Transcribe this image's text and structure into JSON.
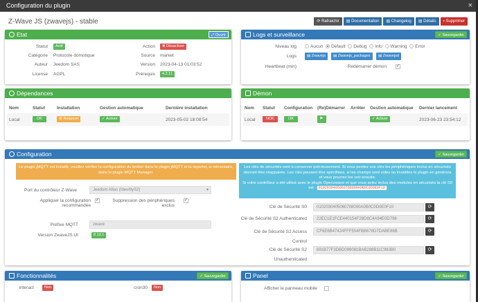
{
  "window": {
    "title": "Configuration du plugin",
    "close": "×"
  },
  "plugin_title": "Z-Wave JS (zwavejs) - stable",
  "toolbar": {
    "refresh": "Rafraichir",
    "doc": "Documentation",
    "changelog": "Changelog",
    "details": "Détails",
    "delete": "Supprimer"
  },
  "etat": {
    "title": "Etat",
    "open": "Ouvrir",
    "statut_lbl": "Statut",
    "statut": "Actif",
    "categorie_lbl": "Catégorie",
    "categorie": "Protocole domotique",
    "auteur_lbl": "Auteur",
    "auteur": "Jeedom SAS",
    "licence_lbl": "License",
    "licence": "AGPL",
    "action_lbl": "Action",
    "action": "Désactiver",
    "source_lbl": "Source",
    "source": "market",
    "version_lbl": "Version",
    "version": "2023-04-13 01:03:52",
    "prerequis_lbl": "Prérequis",
    "prerequis": "4.2.11"
  },
  "logs": {
    "title": "Logs et surveillance",
    "save": "Sauvegarder",
    "niveau_lbl": "Niveau log",
    "levels": [
      "Aucun",
      "Default",
      "Debug",
      "Info",
      "Warning",
      "Error"
    ],
    "logs_lbl": "Logs",
    "log_btns": [
      "Zwavejs",
      "Zwavejs_packages",
      "Zwavejsd"
    ],
    "heartbeat_lbl": "Heartbeat (min)",
    "restart_lbl": "Redémarrer démon"
  },
  "deps": {
    "title": "Dépendances",
    "h_nom": "Nom",
    "h_statut": "Statut",
    "h_install": "Installation",
    "h_gestion": "Gestion automatique",
    "h_derniere": "Dernière installation",
    "nom": "Local",
    "statut": "OK",
    "relancer": "Relancer",
    "activer": "Activer",
    "date": "2023-05-02 18:08:54"
  },
  "demon": {
    "title": "Démon",
    "h_nom": "Nom",
    "h_statut": "Statut",
    "h_config": "Configuration",
    "h_redem": "(Re)Démarrer",
    "h_arret": "Arrêter",
    "h_gestion": "Gestion automatique",
    "h_dernier": "Dernier lancement",
    "nom": "Local",
    "statut": "NOK",
    "config": "OK",
    "activer": "Activer",
    "date": "2023-06-23 23:54:12"
  },
  "config": {
    "title": "Configuration",
    "save": "Sauvegarder",
    "warn": "Le plugin jMQTT est installé, veuillez vérifier la configuration du broker dans le plugin jMQTT et la reporter, si nécessaire, dans le plugin MQTT Manager.",
    "info1": "Les clés de sécurités sont à conserver précieusement. Si vous perdez vos clés les périphériques inclus en sécurisés devront être réappairés. Les clés peuvent être spécifiées, si les champs sont vides ou invalides le plugin en générera et vous pourrez les voir ensuite.",
    "info2": "Si votre contrôleur a été utilisé avec le plugin Openzwave et que vous aviez inclus des modules en sécurisés la clé S0 est :",
    "info_key": "0102030405060708090A0B0C0D0E0F10",
    "port_lbl": "Port du contrôleur Z-Wave",
    "port": "Jeedom Atlas (/dev/ttyS2)",
    "apply_lbl1": "Appliquer la configuration",
    "apply_lbl2": "recommandée",
    "suppr_lbl1": "Suppression des périphériques",
    "suppr_lbl2": "exclus",
    "prefix_lbl": "Préfixe MQTT",
    "prefix": "zwave",
    "ver_lbl": "Version ZwaveJS UI",
    "ver": "8.13.1",
    "s0_lbl": "Clé de Sécurité S0",
    "s0": "0102030405060708090A0B0C0D0E0F10",
    "s2auth_lbl": "Clé de Sécurité S2 Authenticated",
    "s2auth": "22EC1E1FCE440154F28D8C4A94E0D798",
    "s2ac_lbl1": "Clé de Sécurité S2 Access",
    "s2ac_lbl2": "Control",
    "s2ac": "CF6E6B47424FFF554FBB678D7DABE86B",
    "s2un_lbl1": "Clé de Sécurité S2",
    "s2un_lbl2": "Unauthenticated",
    "s2un": "691B77F3DBD099081BAB288B11C983B0"
  },
  "fonct": {
    "title": "Fonctionnalités",
    "save": "Sauvegarder",
    "interact": "interact",
    "interact_v": "Non",
    "cron30": "cron30",
    "cron30_v": "Non"
  },
  "panel": {
    "title": "Panel",
    "save": "Sauvegarder",
    "afficher": "Afficher le panneau mobile"
  }
}
